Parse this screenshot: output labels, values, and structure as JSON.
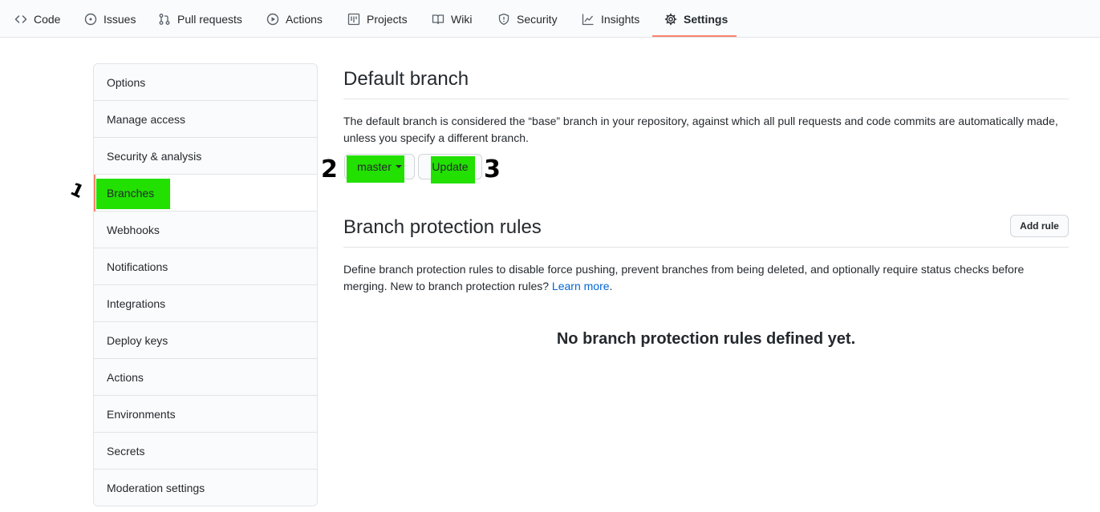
{
  "nav": {
    "tabs": [
      {
        "label": "Code",
        "icon": "code-icon"
      },
      {
        "label": "Issues",
        "icon": "issue-icon"
      },
      {
        "label": "Pull requests",
        "icon": "pull-request-icon"
      },
      {
        "label": "Actions",
        "icon": "play-icon"
      },
      {
        "label": "Projects",
        "icon": "project-icon"
      },
      {
        "label": "Wiki",
        "icon": "book-icon"
      },
      {
        "label": "Security",
        "icon": "shield-icon"
      },
      {
        "label": "Insights",
        "icon": "graph-icon"
      },
      {
        "label": "Settings",
        "icon": "gear-icon",
        "selected": true
      }
    ]
  },
  "sidebar": {
    "items": [
      {
        "label": "Options"
      },
      {
        "label": "Manage access"
      },
      {
        "label": "Security & analysis"
      },
      {
        "label": "Branches",
        "selected": true
      },
      {
        "label": "Webhooks"
      },
      {
        "label": "Notifications"
      },
      {
        "label": "Integrations"
      },
      {
        "label": "Deploy keys"
      },
      {
        "label": "Actions"
      },
      {
        "label": "Environments"
      },
      {
        "label": "Secrets"
      },
      {
        "label": "Moderation settings"
      }
    ]
  },
  "default_branch": {
    "title": "Default branch",
    "description": "The default branch is considered the “base” branch in your repository, against which all pull requests and code commits are automatically made, unless you specify a different branch.",
    "branch_select": "master",
    "update_button": "Update"
  },
  "protection": {
    "title": "Branch protection rules",
    "add_rule_button": "Add rule",
    "description": "Define branch protection rules to disable force pushing, prevent branches from being deleted, and optionally require status checks before merging. New to branch protection rules?",
    "learn_more": "Learn more",
    "period": ".",
    "empty": "No branch protection rules defined yet."
  },
  "annotations": {
    "step1": "1",
    "step2": "2",
    "step3": "3"
  },
  "colors": {
    "accent_underline": "#f9826c",
    "highlight": "#22e000",
    "link": "#0366d6"
  }
}
